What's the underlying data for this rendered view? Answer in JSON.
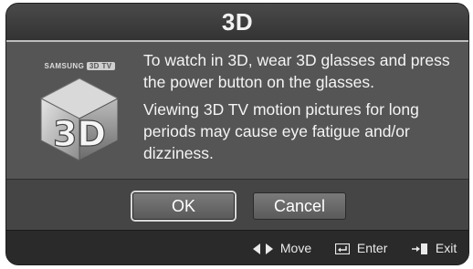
{
  "dialog": {
    "title": "3D",
    "logo": {
      "brand": "SAMSUNG",
      "tag": "3D TV",
      "glyph": "3D"
    },
    "message": [
      "To watch in 3D, wear 3D glasses and press the power button on the glasses.",
      "Viewing 3D TV motion pictures for long periods may cause eye fatigue and/or dizziness."
    ],
    "buttons": {
      "ok": "OK",
      "cancel": "Cancel"
    }
  },
  "footer": {
    "move": {
      "icon": "left-right-arrows-icon",
      "label": "Move"
    },
    "enter": {
      "icon": "enter-icon",
      "label": "Enter"
    },
    "exit": {
      "icon": "exit-icon",
      "label": "Exit"
    }
  }
}
